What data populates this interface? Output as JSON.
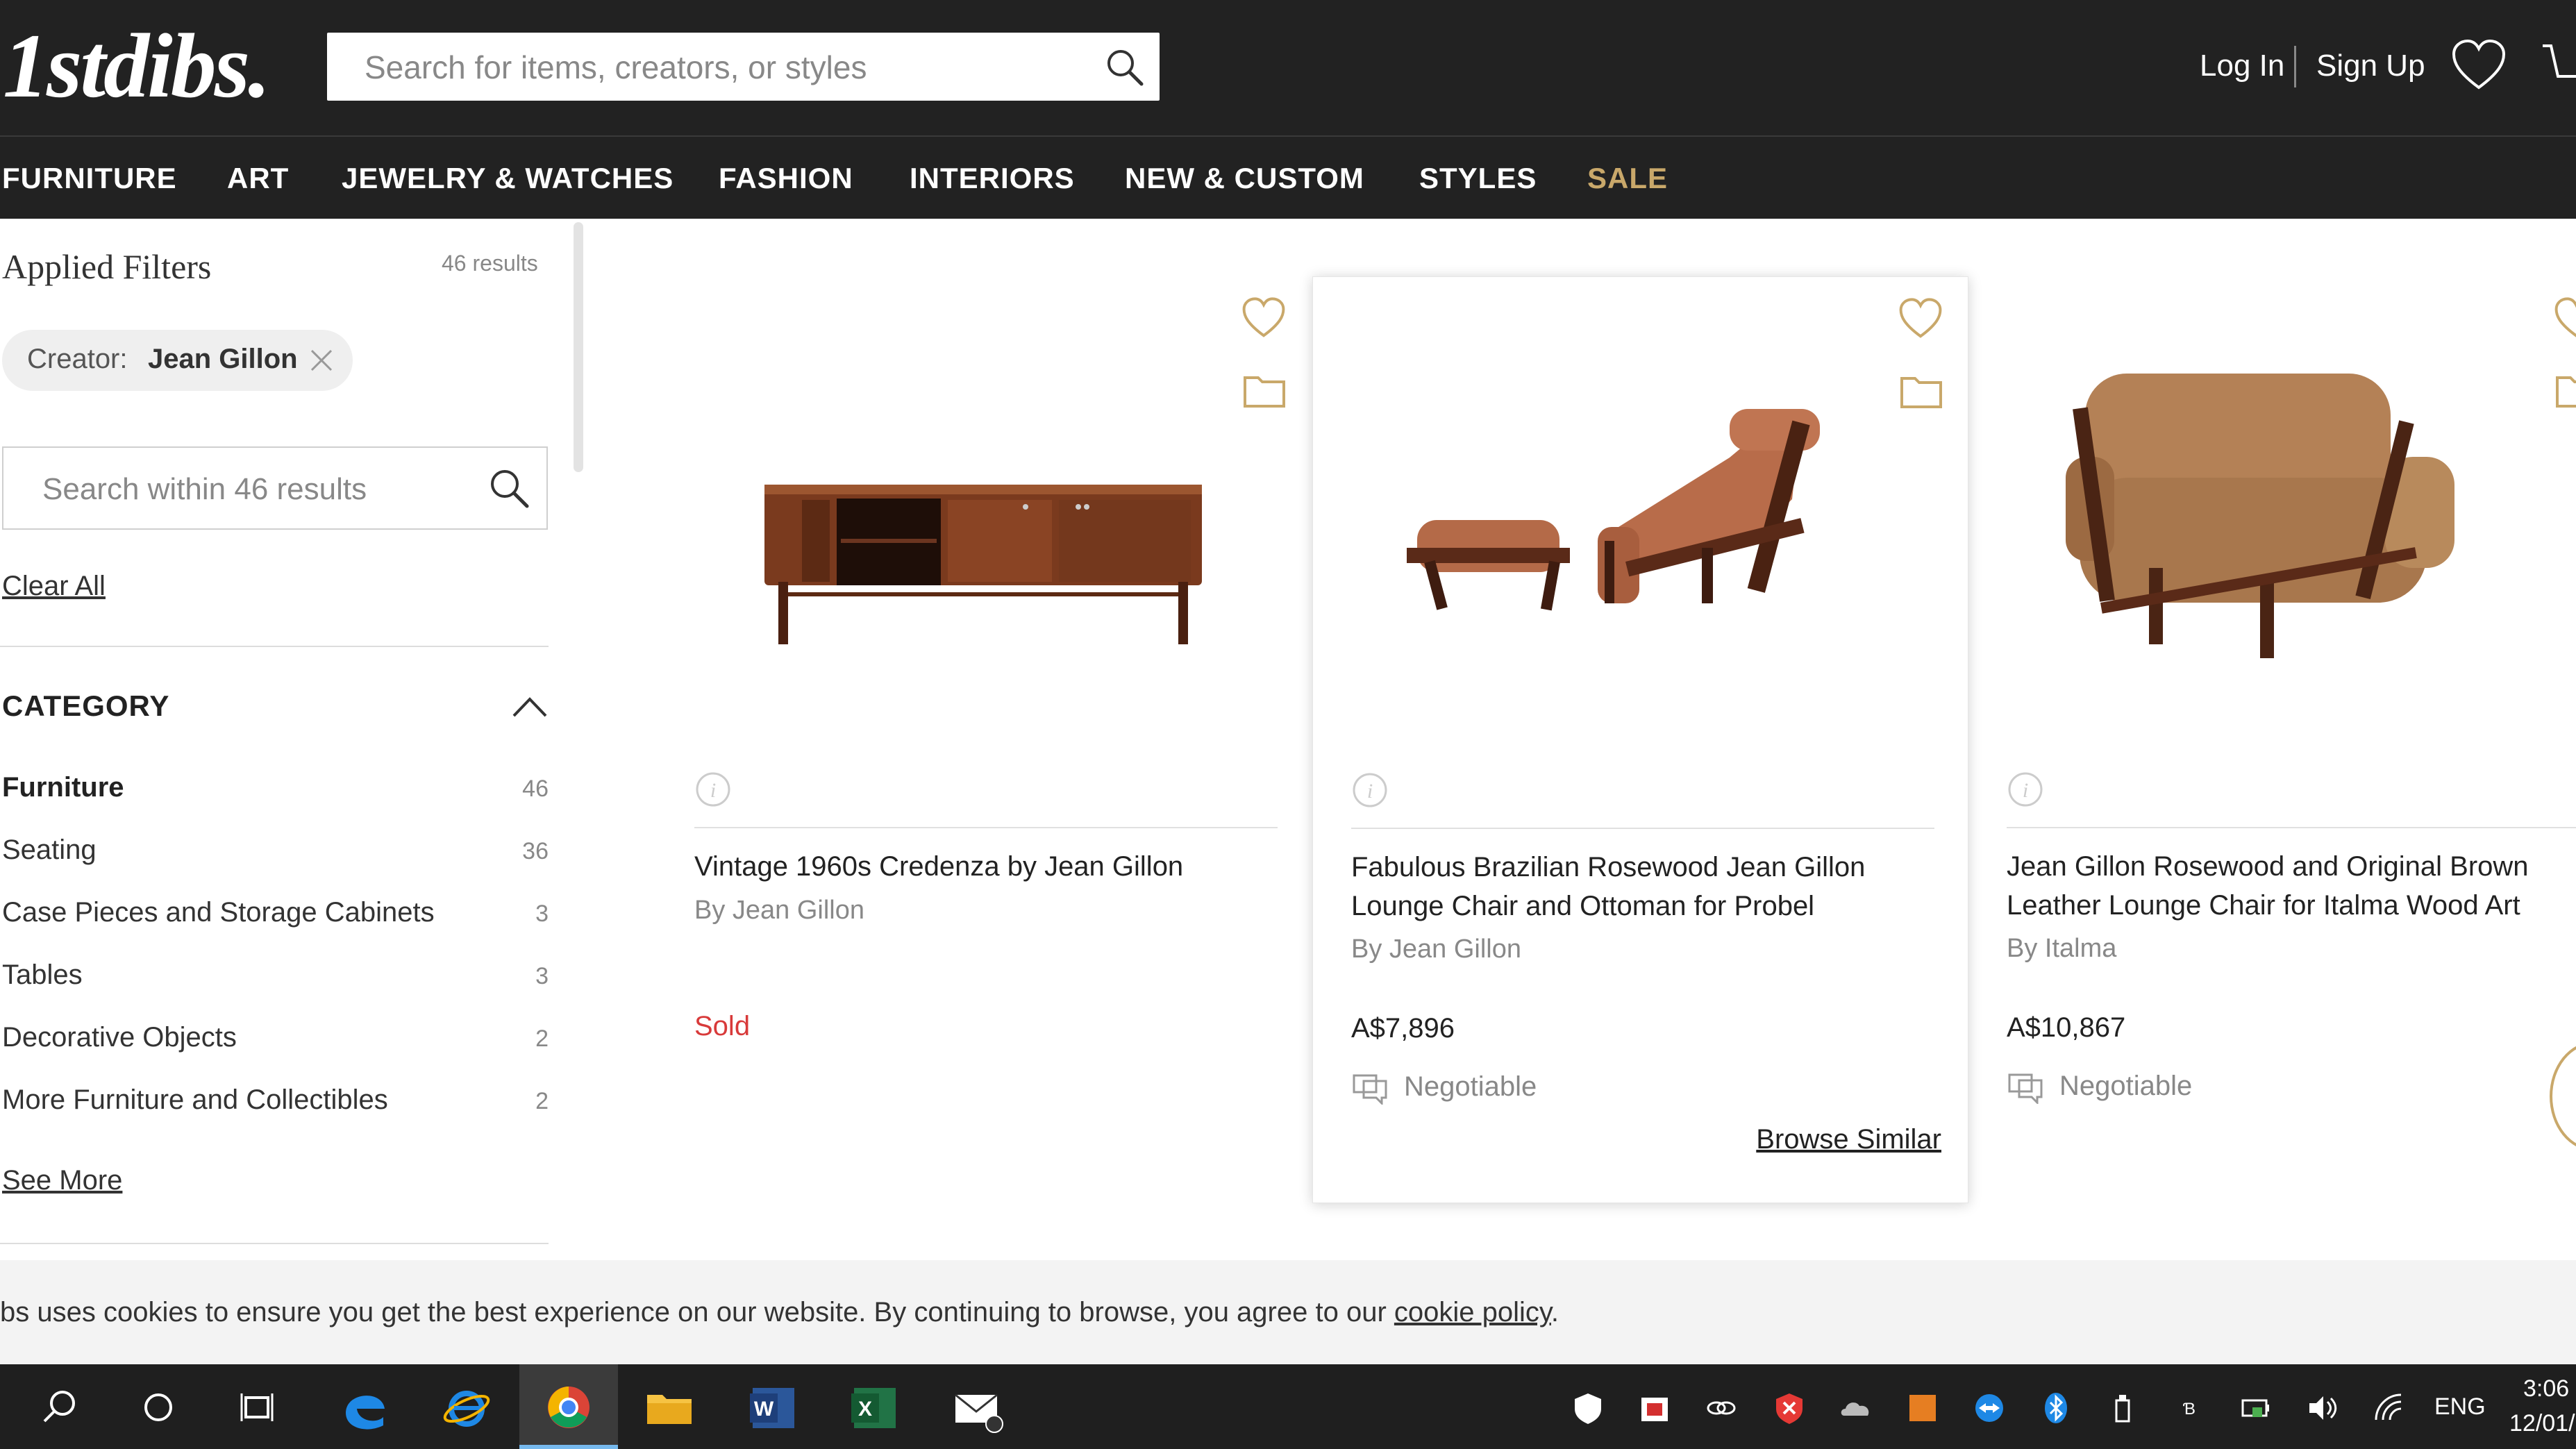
{
  "brand": {
    "logo": "1stdibs."
  },
  "header": {
    "search_placeholder": "Search for items, creators, or styles",
    "login": "Log In",
    "signup": "Sign Up"
  },
  "nav": [
    "FURNITURE",
    "ART",
    "JEWELRY & WATCHES",
    "FASHION",
    "INTERIORS",
    "NEW & CUSTOM",
    "STYLES",
    "SALE"
  ],
  "sidebar": {
    "applied_title": "Applied Filters",
    "results_count": "46 results",
    "chip_key": "Creator:",
    "chip_value": "Jean Gillon",
    "inner_search_placeholder": "Search within 46 results",
    "clear_all": "Clear All",
    "category_title": "CATEGORY",
    "categories": [
      {
        "label": "Furniture",
        "count": "46"
      },
      {
        "label": "Seating",
        "count": "36"
      },
      {
        "label": "Case Pieces and Storage Cabinets",
        "count": "3"
      },
      {
        "label": "Tables",
        "count": "3"
      },
      {
        "label": "Decorative Objects",
        "count": "2"
      },
      {
        "label": "More Furniture and Collectibles",
        "count": "2"
      }
    ],
    "see_more": "See More"
  },
  "products": [
    {
      "title": "Vintage 1960s Credenza by Jean Gillon",
      "by": "By Jean Gillon",
      "status": "Sold"
    },
    {
      "title": "Fabulous Brazilian Rosewood Jean Gillon Lounge Chair and Ottoman for Probel",
      "by": "By Jean Gillon",
      "price": "A$7,896",
      "negotiable": "Negotiable",
      "browse": "Browse Similar"
    },
    {
      "title": "Jean Gillon Rosewood and Original Brown Leather Lounge Chair for Italma Wood Art",
      "by": "By Italma",
      "price": "A$10,867",
      "negotiable": "Negotiable"
    }
  ],
  "cookie": {
    "text": "bs uses cookies to ensure you get the best experience on our website. By continuing to browse, you agree to our ",
    "link": "cookie policy",
    "end": "."
  },
  "taskbar": {
    "lang": "ENG",
    "time": "3:06",
    "date": "12/01/"
  },
  "colors": {
    "header_bg": "#222222",
    "sale": "#c9a86a",
    "sold": "#d83a3a",
    "heart": "#c9a86a"
  }
}
